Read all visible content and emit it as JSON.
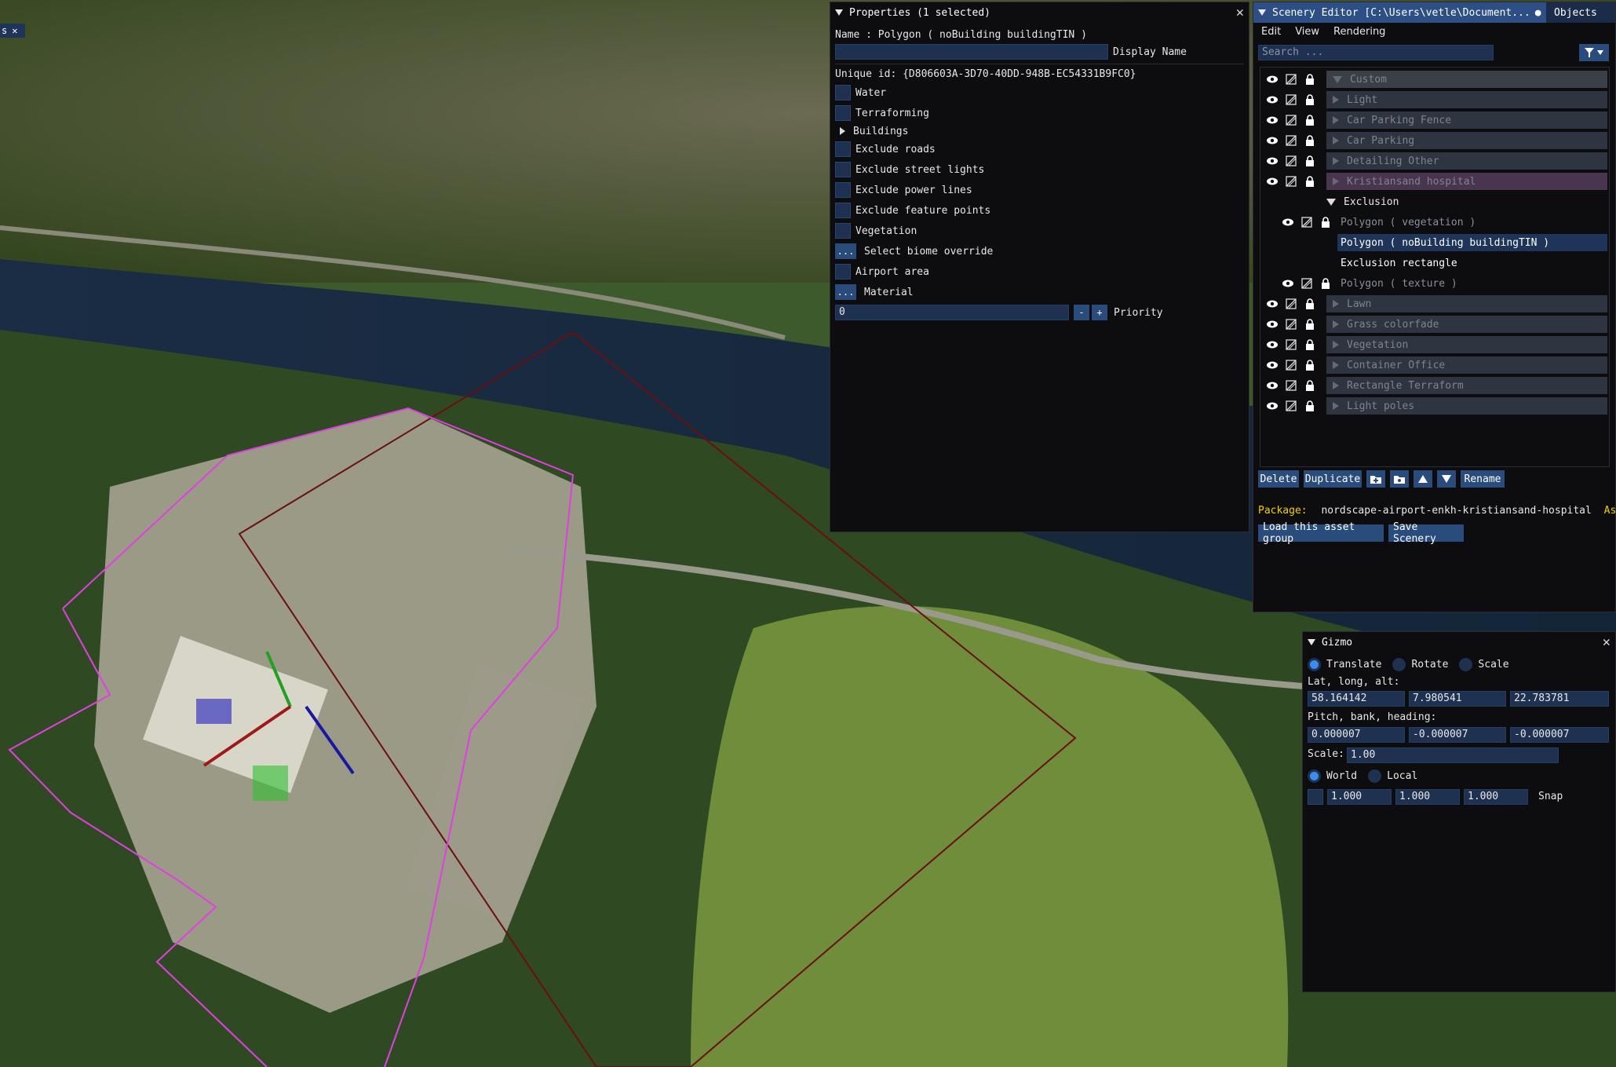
{
  "viewport": {
    "name": "3D scenery viewport",
    "corner_tab_label": "s",
    "colors": {
      "forest": "#2f4a22",
      "river": "#1b2f45",
      "field": "#6f8d3a",
      "campus": "#a7a391",
      "polygon": "#e040e0",
      "box": "#6a0f0f"
    }
  },
  "properties": {
    "title": "Properties (1 selected)",
    "name_line": "Name : Polygon  ( noBuilding buildingTIN )",
    "display_name_value": "",
    "display_name_label": "Display Name",
    "unique_id": "Unique id: {D806603A-3D70-40DD-948B-EC54331B9FC0}",
    "checkboxes": [
      "Water",
      "Terraforming"
    ],
    "buildings_label": "Buildings",
    "checkboxes2": [
      "Exclude roads",
      "Exclude street lights",
      "Exclude power lines",
      "Exclude feature points",
      "Vegetation"
    ],
    "biome_button": "...",
    "biome_label": "Select biome override",
    "airport_label": "Airport area",
    "material_button": "...",
    "material_label": "Material",
    "priority_value": "0",
    "priority_minus": "-",
    "priority_plus": "+",
    "priority_label": "Priority"
  },
  "scenery": {
    "title": "Scenery Editor [C:\\Users\\vetle\\Document...",
    "objects_tab": "Objects",
    "menu": [
      "Edit",
      "View",
      "Rendering"
    ],
    "search_placeholder": "Search ...",
    "tree": [
      {
        "label": "Custom",
        "state": "open-grey"
      },
      {
        "label": "Light"
      },
      {
        "label": "Car Parking Fence"
      },
      {
        "label": "Car Parking"
      },
      {
        "label": "Detailing Other"
      },
      {
        "label": "Kristiansand hospital",
        "state": "selected"
      },
      {
        "label": "Exclusion"
      },
      {
        "label": "Polygon  ( vegetation )"
      },
      {
        "label": "Polygon  ( noBuilding buildingTIN )"
      },
      {
        "label": "Exclusion rectangle"
      },
      {
        "label": "Polygon  ( texture )"
      },
      {
        "label": "Lawn"
      },
      {
        "label": "Grass colorfade"
      },
      {
        "label": "Vegetation"
      },
      {
        "label": "Container Office"
      },
      {
        "label": "Rectangle Terraform"
      },
      {
        "label": "Light poles"
      }
    ],
    "buttons": {
      "delete": "Delete",
      "duplicate": "Duplicate",
      "rename": "Rename"
    },
    "package_label": "Package:",
    "package_value": "nordscape-airport-enkh-kristiansand-hospital",
    "asset_label": "Asset:",
    "load_button": "Load this asset group",
    "save_button": "Save Scenery"
  },
  "gizmo": {
    "title": "Gizmo",
    "modes": [
      "Translate",
      "Rotate",
      "Scale"
    ],
    "active_mode": "Translate",
    "latlong_label": "Lat, long, alt:",
    "lat": "58.164142",
    "long": "7.980541",
    "alt": "22.783781",
    "pbh_label": "Pitch, bank, heading:",
    "pitch": "0.000007",
    "bank": "-0.000007",
    "heading": "-0.000007",
    "scale_label": "Scale:",
    "scale": "1.00",
    "spaces": [
      "World",
      "Local"
    ],
    "active_space": "World",
    "snap_x": "1.000",
    "snap_y": "1.000",
    "snap_z": "1.000",
    "snap_label": "Snap"
  }
}
